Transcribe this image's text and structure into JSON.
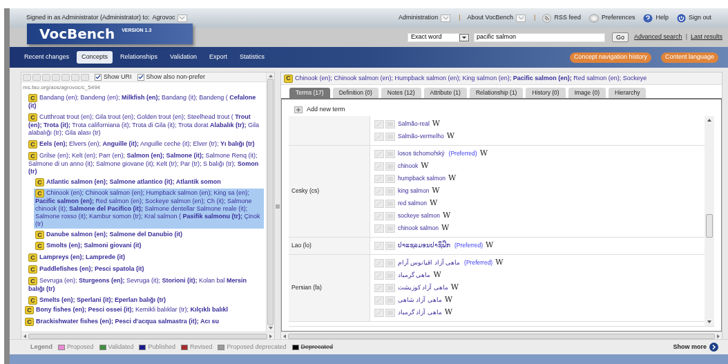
{
  "top_bar": {
    "signed_in": "Signed in as Administrator (Administrator) to:",
    "project": "Agrovoc",
    "menus": [
      {
        "label": "Administration",
        "kind": "dropdown"
      },
      {
        "label": "About VocBench",
        "kind": "dropdown",
        "separator": "|"
      },
      {
        "label": "RSS feed",
        "kind": "rss",
        "separator": "|"
      },
      {
        "label": "Preferences",
        "kind": "gear"
      },
      {
        "label": "Help",
        "kind": "help"
      },
      {
        "label": "Sign out",
        "kind": "power"
      }
    ]
  },
  "logo": {
    "name": "VocBench",
    "version": "VERSION 1.3"
  },
  "search": {
    "mode": "Exact word",
    "value": "pacific salmon",
    "go": "Go",
    "links": [
      "Advanced search",
      "Last results"
    ],
    "separator": "|"
  },
  "nav": {
    "tabs": [
      {
        "label": "Recent changes",
        "selected": false
      },
      {
        "label": "Concepts",
        "selected": true
      },
      {
        "label": "Relationships",
        "selected": false
      },
      {
        "label": "Validation",
        "selected": false
      },
      {
        "label": "Export",
        "selected": false
      },
      {
        "label": "Statistics",
        "selected": false
      }
    ],
    "buttons": [
      "Concept navigation history",
      "Content language"
    ]
  },
  "tree": {
    "toolbar": {
      "options": [
        {
          "label": "Show URI",
          "checked": true
        },
        {
          "label": "Show also non-prefer",
          "checked": true
        }
      ]
    },
    "uri": "ms.fao.org/aos/agrovoc/c_5494",
    "items": [
      {
        "badge": "C",
        "text": "Bandang (en); Bandeng (en); **Milkfish (en);** Bandang (it); Bandeng ( **Cefalone (it)**",
        "selected": false
      },
      {
        "badge": "C",
        "text": "Cutthroat trout (en); Gila trout (en); Golden trout (en); Steelhead trout ( **Trout (en); Trota (it);** Trota californiana (it); Trota di Gila (it); Trota dorat **Alabalık (tr);** Gila alabalığı (tr); Gila alası (tr)",
        "selected": false
      },
      {
        "badge": "C",
        "text": "**Eels (en);** Elvers (en); **Anguille (it);** Anguille ceche (it); Elver (tr); **Yı balığı (tr)**",
        "selected": false
      },
      {
        "badge": "C",
        "text": "Grilse (en); Kelt (en); Parr (en); **Salmon (en); Salmone (it);** Salmone Renq (it); Salmone di un anno (it); Salmone giovane (it); Kelt (tr); Par (tr); S balığı (tr); **Somon (tr)**",
        "selected": false,
        "children": [
          {
            "badge": "C",
            "text": "**Atlantic salmon (en); Salmone atlantico (it); Atlantik somon**",
            "selected": false
          },
          {
            "badge": "C",
            "text": "Chinook (en); Chinook salmon (en); Humpback salmon (en); King sa (en); **Pacific salmon (en);** Red salmon (en); Sockeye salmon (en); Ch (it); Salmone chinook (it); **Salmone del Pacifico (it);** Salmone dentellar Salmone reale (it); Salmone rosso (it); Kambur somon (tr); Kral salmon ( **Pasifik salmonu (tr);** Çinok (tr)",
            "selected": true
          },
          {
            "badge": "C",
            "text": "**Danube salmon (en); Salmone del Danubio (it)**",
            "selected": false
          },
          {
            "badge": "C",
            "text": "**Smolts (en); Salmoni giovani (it)**",
            "selected": false
          }
        ]
      },
      {
        "badge": "C",
        "text": "**Lampreys (en); Lamprede (it)**",
        "selected": false
      },
      {
        "badge": "C",
        "text": "**Paddlefishes (en); Pesci spatola (it)**",
        "selected": false
      },
      {
        "badge": "C",
        "text": "Sevruga (en); **Sturgeons (en);** Sevruga (it); **Storioni (it);** Kolan bal **Mersin balığı (tr)**",
        "selected": false
      },
      {
        "badge": "C",
        "text": "**Smelts (en); Sperlani (it); Eperlan balığı (tr)**",
        "selected": false
      }
    ],
    "parent_level_items": [
      {
        "badge": "C",
        "text": "**Bony fishes (en); Pesci ossei (it);** Kemikli balıklar (tr); **Kılçıklı balıkl**",
        "selected": false
      },
      {
        "badge": "C",
        "text": "**Brackishwater fishes (en); Pesci d'acqua salmastra (it); Acı su**",
        "selected": false
      }
    ]
  },
  "concept": {
    "badge": "C",
    "text": "Chinook (en); Chinook salmon (en); Humpback salmon (en); King salmon (en); **Pacific salmon (en);** Red salmon (en); Sockeye",
    "tabs": [
      {
        "label": "Terms (17)",
        "selected": true
      },
      {
        "label": "Definition (0)",
        "selected": false
      },
      {
        "label": "Notes (12)",
        "selected": false
      },
      {
        "label": "Attribute (1)",
        "selected": false
      },
      {
        "label": "Relationship (1)",
        "selected": false
      },
      {
        "label": "History (0)",
        "selected": false
      },
      {
        "label": "Image (0)",
        "selected": false
      },
      {
        "label": "Hierarchy",
        "selected": false
      }
    ],
    "add_term": "Add new term",
    "groups": [
      {
        "terms": [
          {
            "text": "Salmão-real",
            "wiki": "W"
          },
          {
            "text": "Salmão-vermelho",
            "wiki": "W"
          }
        ]
      },
      {
        "language": "Cesky (cs)",
        "terms": [
          {
            "text": "losos tichomořský",
            "tag": "(Preferred)",
            "wiki": "W"
          },
          {
            "text": "chinook",
            "wiki": "W"
          },
          {
            "text": "humpback salmon",
            "wiki": "W"
          },
          {
            "text": "king salmon",
            "wiki": "W"
          },
          {
            "text": "red salmon",
            "wiki": "W"
          },
          {
            "text": "sockeye salmon",
            "wiki": "W"
          },
          {
            "text": "chinook salmon",
            "wiki": "W"
          }
        ]
      },
      {
        "language": "Lao (lo)",
        "terms": [
          {
            "text": "ປາແຊລມອນປາຊິຟິກ",
            "tag": "(Preferred)",
            "wiki": "W"
          }
        ]
      },
      {
        "language": "Persian (fa)",
        "terms": [
          {
            "text": "ماهی آزاد اقیانوس آرام",
            "tag": "(Preferred)",
            "wiki": "W"
          },
          {
            "text": "ماهی گرمباد",
            "wiki": "W"
          },
          {
            "text": "ماهی آزاد کوزیشت",
            "wiki": "W"
          },
          {
            "text": "ماهی آزاد شاهی",
            "wiki": "W"
          },
          {
            "text": "ماهی آزاد گرمباد",
            "wiki": "W"
          }
        ]
      }
    ]
  },
  "legend": {
    "title": "Legend",
    "items": [
      {
        "label": "Proposed",
        "color": "#e88ad0",
        "struck": false
      },
      {
        "label": "Validated",
        "color": "#3f8f3f",
        "struck": false
      },
      {
        "label": "Published",
        "color": "#1a1a8c",
        "struck": false
      },
      {
        "label": "Revised",
        "color": "#a52a2a",
        "struck": false
      },
      {
        "label": "Proposed deprecated",
        "color": "#9a9a9a",
        "struck": false
      },
      {
        "label": "Deprecated",
        "color": "#000000",
        "struck": true
      }
    ],
    "show_more": "Show more"
  }
}
